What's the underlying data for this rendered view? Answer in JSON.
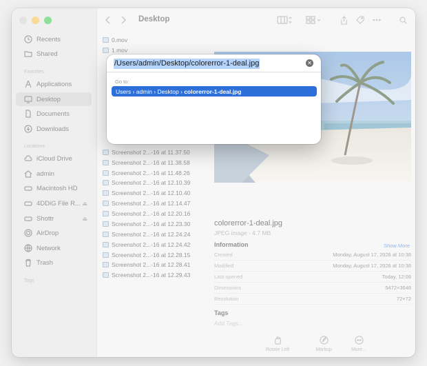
{
  "window": {
    "title": "Desktop"
  },
  "sidebar": {
    "favorites_header": "Favorites",
    "locations_header": "Locations",
    "tags_header": "Tags",
    "top_items": [
      {
        "label": "Recents",
        "icon": "clock-icon"
      },
      {
        "label": "Shared",
        "icon": "shared-folder-icon"
      }
    ],
    "favorites": [
      {
        "label": "Applications",
        "icon": "applications-icon"
      },
      {
        "label": "Desktop",
        "icon": "desktop-icon",
        "selected": true
      },
      {
        "label": "Documents",
        "icon": "document-icon"
      },
      {
        "label": "Downloads",
        "icon": "download-icon"
      }
    ],
    "locations": [
      {
        "label": "iCloud Drive",
        "icon": "cloud-icon"
      },
      {
        "label": "admin",
        "icon": "home-icon"
      },
      {
        "label": "Macintosh HD",
        "icon": "disk-icon"
      },
      {
        "label": "4DDiG File R...",
        "icon": "disk-icon",
        "eject": true
      },
      {
        "label": "Shottr",
        "icon": "disk-icon",
        "eject": true
      },
      {
        "label": "AirDrop",
        "icon": "airdrop-icon"
      },
      {
        "label": "Network",
        "icon": "network-icon"
      },
      {
        "label": "Trash",
        "icon": "trash-icon"
      }
    ]
  },
  "files": [
    "0.mov",
    "1.mov",
    "Screenshot 2...-16 at 11.37.50",
    "Screenshot 2...-16 at 11.38.58",
    "Screenshot 2...-16 at 11.48.26",
    "Screenshot 2...-16 at 12.10.39",
    "Screenshot 2...-16 at 12.10.40",
    "Screenshot 2...-16 at 12.14.47",
    "Screenshot 2...-16 at 12.20.16",
    "Screenshot 2...-16 at 12.23.30",
    "Screenshot 2...-16 at 12.24.24",
    "Screenshot 2...-16 at 12.24.42",
    "Screenshot 2...-16 at 12.28.15",
    "Screenshot 2...-16 at 12.28.41",
    "Screenshot 2...-16 at 12.29.43"
  ],
  "preview": {
    "filename": "colorerror-1-deal.jpg",
    "kind": "JPEG image - 4.7 MB",
    "information_header": "Information",
    "show_more": "Show More",
    "info": [
      {
        "key": "Created",
        "value": "Monday, August 17, 2026 at 10:38"
      },
      {
        "key": "Modified",
        "value": "Monday, August 17, 2026 at 10:38"
      },
      {
        "key": "Last opened",
        "value": "Today, 12:08"
      },
      {
        "key": "Dimensions",
        "value": "5472×3648"
      },
      {
        "key": "Resolution",
        "value": "72×72"
      }
    ],
    "tags_header": "Tags",
    "add_tags": "Add Tags...",
    "actions": [
      {
        "label": "Rotate Left",
        "icon": "rotate-left-icon"
      },
      {
        "label": "Markup",
        "icon": "markup-icon"
      },
      {
        "label": "More...",
        "icon": "more-icon"
      }
    ]
  },
  "goto": {
    "path_value": "/Users/admin/Desktop/colorerror-1-deal.jpg",
    "label": "Go to:",
    "breadcrumb": [
      "Users",
      "admin",
      "Desktop"
    ],
    "breadcrumb_sep": "›",
    "breadcrumb_last": "colorerror-1-deal.jpg"
  },
  "colors": {
    "accent": "#2d6fd9",
    "selection": "#b5d4fc"
  }
}
